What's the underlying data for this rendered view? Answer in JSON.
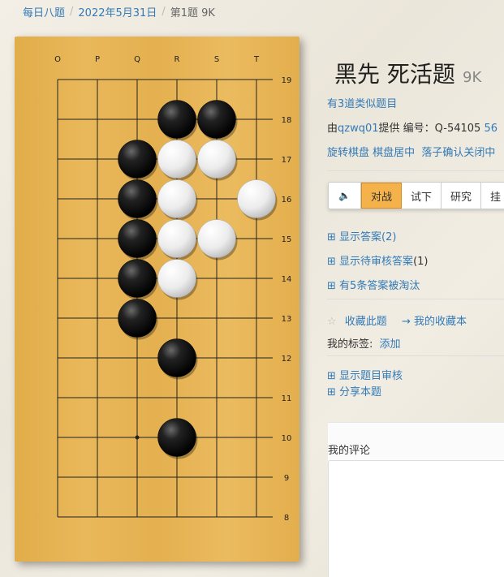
{
  "breadcrumb": {
    "item1": "每日八题",
    "item2": "2022年5月31日",
    "current": "第1题 9K"
  },
  "board": {
    "col_labels": [
      "O",
      "P",
      "Q",
      "R",
      "S",
      "T"
    ],
    "row_labels": [
      "19",
      "18",
      "17",
      "16",
      "15",
      "14",
      "13",
      "12",
      "11",
      "10",
      "9",
      "8"
    ],
    "black_stones": [
      "R18",
      "S18",
      "Q17",
      "Q16",
      "Q15",
      "Q14",
      "Q13",
      "R12",
      "R10"
    ],
    "white_stones": [
      "R17",
      "S17",
      "R16",
      "T16",
      "R15",
      "S15",
      "R14"
    ],
    "star_points": [
      "Q10"
    ]
  },
  "problem": {
    "title": "黑先 死活题",
    "level": "9K",
    "similar": "有3道类似题目",
    "provided_prefix": "由",
    "author": "qzwq01",
    "provided_suffix": "提供 编号：Q-54105",
    "extra_num": "56",
    "rotate": "旋转棋盘",
    "center": "棋盘居中",
    "confirm": "落子确认关闭中"
  },
  "toolbar": {
    "mute_icon": "🔈",
    "fight": "对战",
    "try": "试下",
    "study": "研究",
    "more": "挂"
  },
  "actions": {
    "show_answer": "显示答案(2)",
    "show_pending_label": "显示待审核答案",
    "show_pending_count": "(1)",
    "eliminated": "有5条答案被淘汰",
    "favorite": "收藏此题",
    "my_favorites": "→ 我的收藏本",
    "my_tags_label": "我的标签:",
    "add_tag": "添加",
    "show_review": "显示题目审核",
    "share": "分享本题",
    "my_comment": "我的评论"
  }
}
